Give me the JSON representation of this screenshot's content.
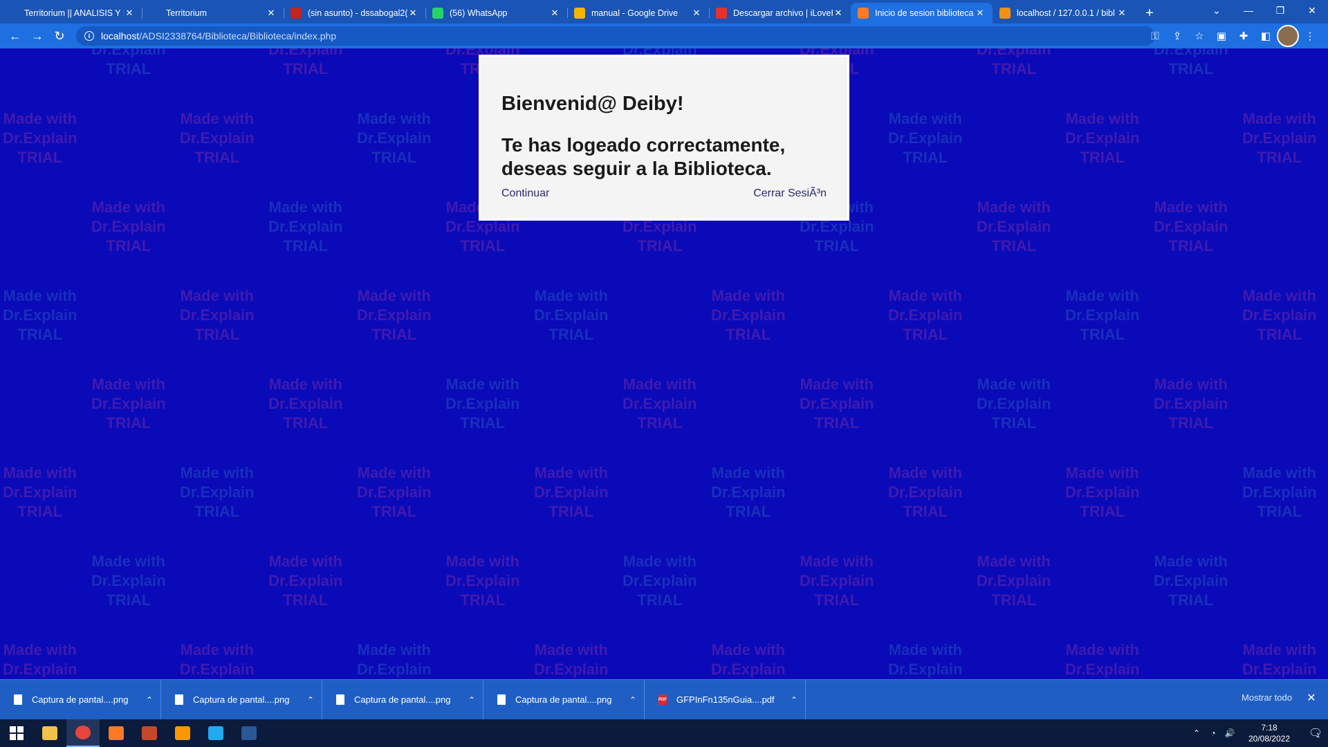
{
  "tabs": [
    {
      "title": "Territorium || ANALISIS Y D",
      "icon": "territorium-icon",
      "color": "#1a55b5",
      "active": false
    },
    {
      "title": "Territorium",
      "icon": "territorium-icon",
      "color": "#1a55b5",
      "active": false
    },
    {
      "title": "(sin asunto) - dssabogal2(",
      "icon": "gmail-icon",
      "color": "#c5221f",
      "active": false
    },
    {
      "title": "(56) WhatsApp",
      "icon": "whatsapp-icon",
      "color": "#25d366",
      "active": false
    },
    {
      "title": "manual - Google Drive",
      "icon": "drive-icon",
      "color": "#f4b400",
      "active": false
    },
    {
      "title": "Descargar archivo | iLoveP",
      "icon": "ilovepdf-icon",
      "color": "#e5322d",
      "active": false
    },
    {
      "title": "Inicio de sesion biblioteca",
      "icon": "xampp-icon",
      "color": "#fb7a24",
      "active": true
    },
    {
      "title": "localhost / 127.0.0.1 / bibl",
      "icon": "phpmyadmin-icon",
      "color": "#f29111",
      "active": false
    }
  ],
  "address": {
    "host": "localhost",
    "path": "/ADSI2338764/Biblioteca/Biblioteca/index.php"
  },
  "modal": {
    "greeting": "Bienvenid@ Deiby!",
    "message": "Te has logeado correctamente, deseas seguir a la Biblioteca.",
    "continue_label": "Continuar",
    "logout_label": "Cerrar SesiÃ³n"
  },
  "watermark": {
    "line1": "Made with",
    "line2": "Dr.Explain",
    "line3": "TRIAL"
  },
  "downloads": {
    "items": [
      {
        "name": "Captura de pantal....png",
        "type": "png"
      },
      {
        "name": "Captura de pantal....png",
        "type": "png"
      },
      {
        "name": "Captura de pantal....png",
        "type": "png"
      },
      {
        "name": "Captura de pantal....png",
        "type": "png"
      },
      {
        "name": "GFPInFn135nGuia....pdf",
        "type": "pdf"
      }
    ],
    "show_all_label": "Mostrar todo"
  },
  "taskbar": {
    "apps": [
      {
        "name": "start-button",
        "color": "#ffffff",
        "active": false
      },
      {
        "name": "file-explorer-icon",
        "color": "#f0c24a",
        "active": false
      },
      {
        "name": "chrome-icon",
        "color": "#e8453c",
        "active": true
      },
      {
        "name": "xampp-icon",
        "color": "#fb7a24",
        "active": false
      },
      {
        "name": "media-app-icon",
        "color": "#c24a2a",
        "active": false
      },
      {
        "name": "sublime-text-icon",
        "color": "#ff9800",
        "active": false
      },
      {
        "name": "vscode-icon",
        "color": "#23a9f2",
        "active": false
      },
      {
        "name": "word-icon",
        "color": "#2b5797",
        "active": false
      }
    ],
    "time": "7:18",
    "date": "20/08/2022",
    "notifications": "1"
  }
}
